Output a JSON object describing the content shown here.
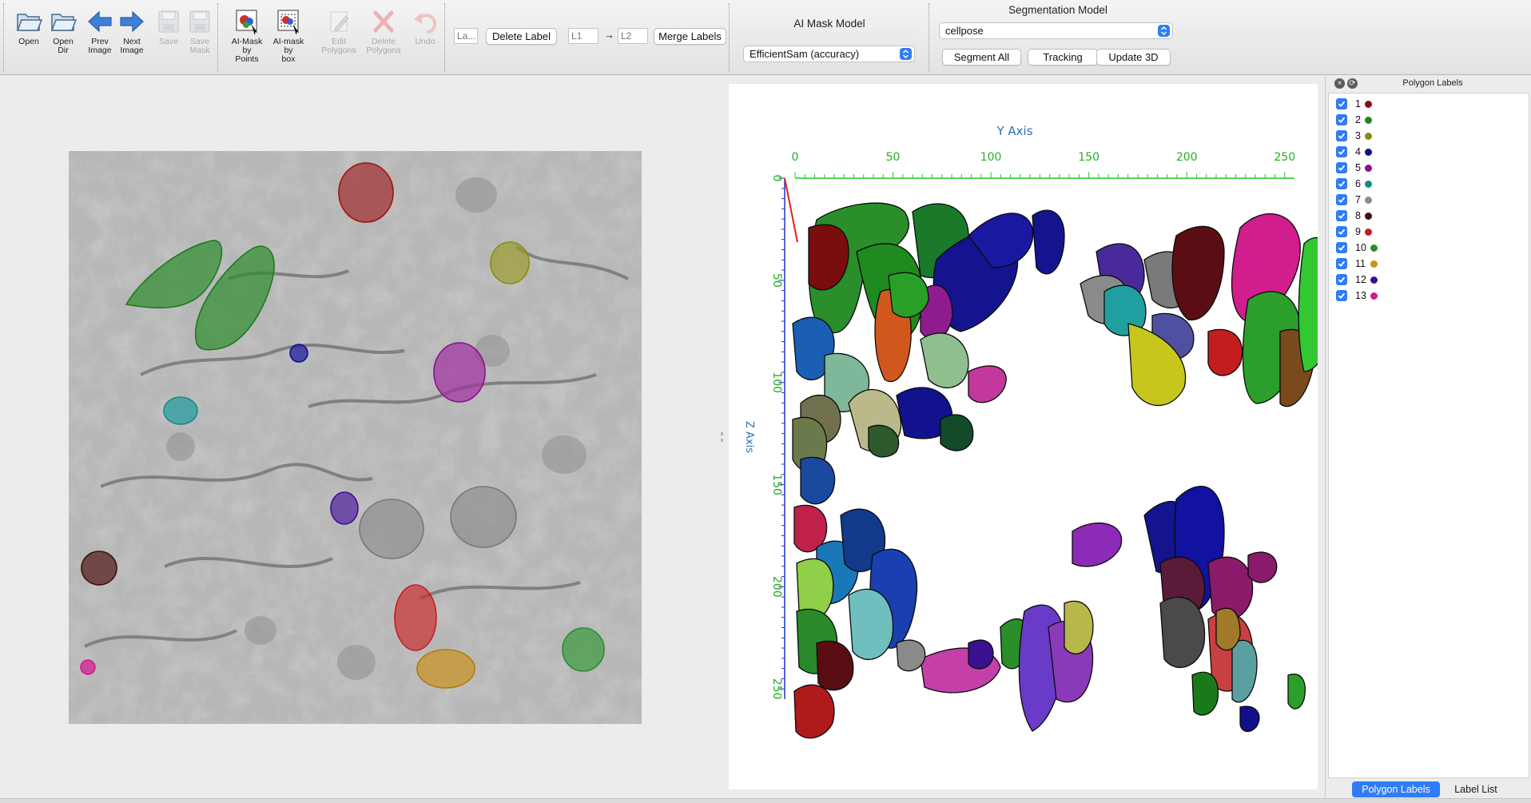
{
  "toolbar": {
    "tools": [
      {
        "id": "open",
        "label": "Open",
        "icon": "folder-open-icon",
        "enabled": true
      },
      {
        "id": "open-dir",
        "label": "Open\nDir",
        "icon": "folder-open-icon",
        "enabled": true
      },
      {
        "id": "prev",
        "label": "Prev\nImage",
        "icon": "arrow-left-icon",
        "enabled": true
      },
      {
        "id": "next",
        "label": "Next\nImage",
        "icon": "arrow-right-icon",
        "enabled": true
      },
      {
        "id": "save",
        "label": "Save",
        "icon": "floppy-disk-icon",
        "enabled": false
      },
      {
        "id": "save-mask",
        "label": "Save\nMask",
        "icon": "floppy-disk-icon",
        "enabled": false
      },
      {
        "id": "ai-points",
        "label": "AI-Mask\nby\nPoints",
        "icon": "ai-mask-points-icon",
        "enabled": true
      },
      {
        "id": "ai-box",
        "label": "AI-mask\nby\nbox",
        "icon": "ai-mask-box-icon",
        "enabled": true
      },
      {
        "id": "edit-poly",
        "label": "Edit\nPolygons",
        "icon": "pencil-icon",
        "enabled": false
      },
      {
        "id": "delete-poly",
        "label": "Delete\nPolygons",
        "icon": "red-x-icon",
        "enabled": false
      },
      {
        "id": "undo",
        "label": "Undo",
        "icon": "undo-arrow-icon",
        "enabled": false
      }
    ],
    "label_input_placeholder": "La...",
    "delete_label": "Delete Label",
    "l1_placeholder": "L1",
    "arrow": "→",
    "l2_placeholder": "L2",
    "merge_labels": "Merge Labels",
    "ai_mask_model_title": "AI Mask Model",
    "ai_mask_model_value": "EfficientSam (accuracy)",
    "segmentation_title": "Segmentation Model",
    "segmentation_value": "cellpose",
    "segment_all": "Segment All",
    "tracking": "Tracking",
    "update_3d": "Update 3D"
  },
  "viewer3d": {
    "y_axis_title": "Y Axis",
    "z_axis_title": "Z Axis",
    "y_ticks": [
      "0",
      "50",
      "100",
      "150",
      "200",
      "250"
    ],
    "z_ticks": [
      "0",
      "50",
      "100",
      "150",
      "200",
      "250"
    ]
  },
  "dock": {
    "title": "Polygon Labels",
    "labels": [
      {
        "num": "1",
        "color": "#8b1010"
      },
      {
        "num": "2",
        "color": "#1e8a1e"
      },
      {
        "num": "3",
        "color": "#8b8b14"
      },
      {
        "num": "4",
        "color": "#10108b"
      },
      {
        "num": "5",
        "color": "#8b108b"
      },
      {
        "num": "6",
        "color": "#138b8b"
      },
      {
        "num": "7",
        "color": "#8c8c8c"
      },
      {
        "num": "8",
        "color": "#3d1010"
      },
      {
        "num": "9",
        "color": "#c41d1d"
      },
      {
        "num": "10",
        "color": "#2e8b2e"
      },
      {
        "num": "11",
        "color": "#c7921e"
      },
      {
        "num": "12",
        "color": "#3a1090"
      },
      {
        "num": "13",
        "color": "#d01e8c"
      }
    ],
    "tab_polygon_labels": "Polygon Labels",
    "tab_label_list": "Label List"
  }
}
